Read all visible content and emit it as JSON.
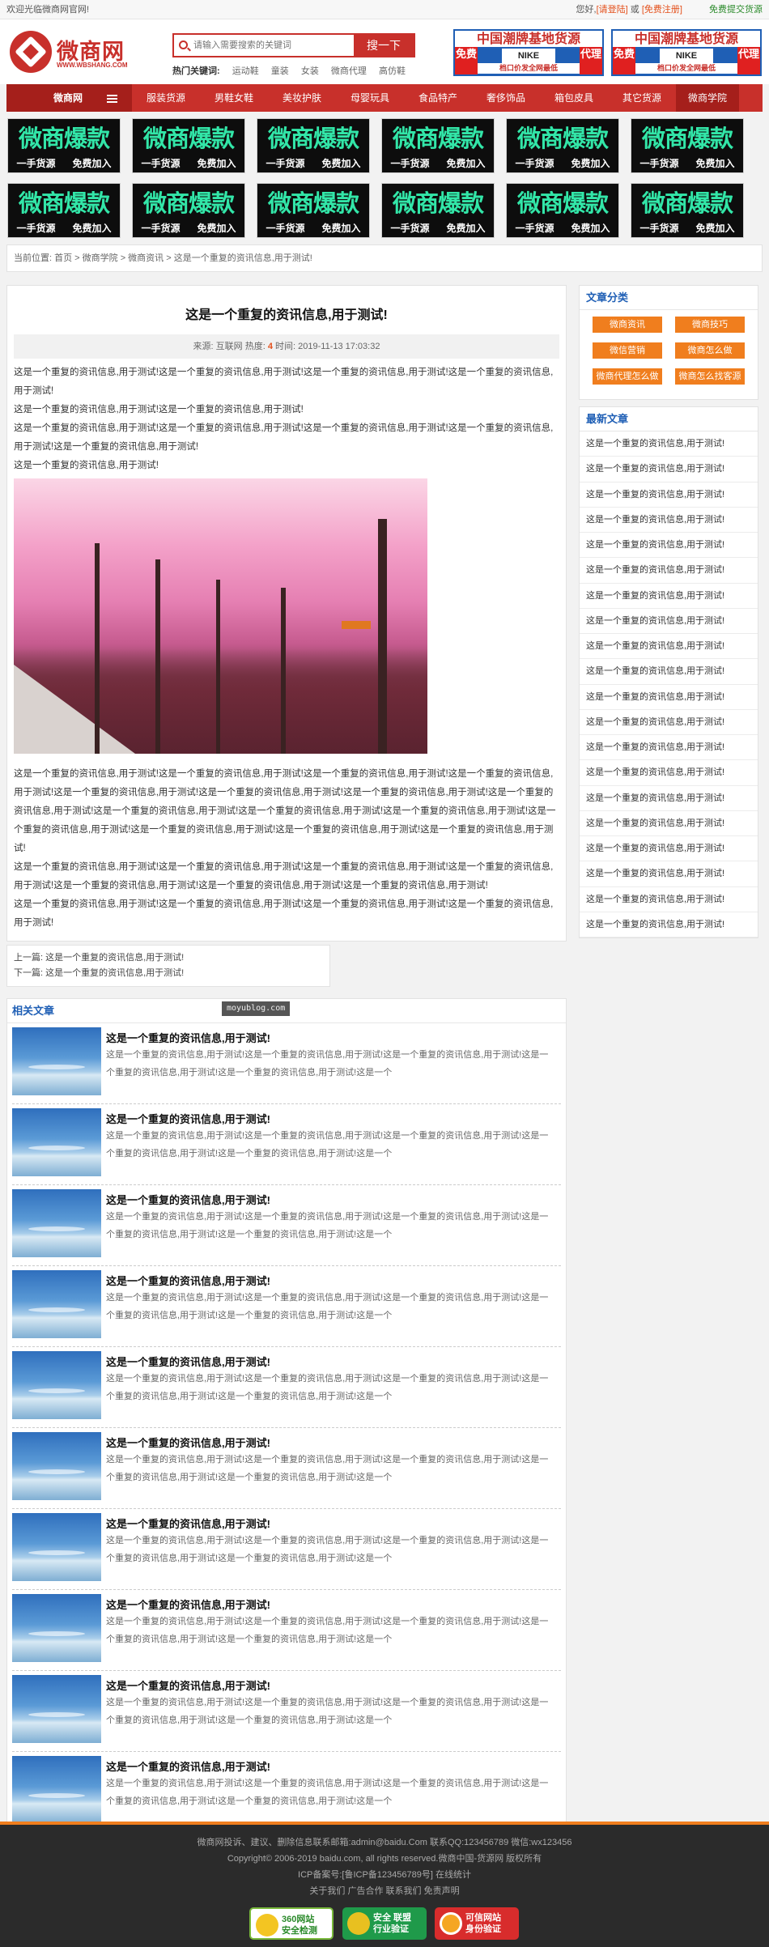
{
  "topbar": {
    "welcome": "欢迎光临微商网官网!",
    "greet": "您好,",
    "login": "[请登陆]",
    "or": "或",
    "register": "[免费注册]",
    "free_submit": "免费提交货源"
  },
  "header": {
    "logo_cn": "微商网",
    "logo_en": "WWW.WBSHANG.COM",
    "search_placeholder": "请输入需要搜索的关键词",
    "search_button": "搜一下",
    "hot_label": "热门关键词:",
    "hot_keywords": [
      "运动鞋",
      "童装",
      "女装",
      "微商代理",
      "高仿鞋"
    ],
    "banner": {
      "title": "中国潮牌基地货源",
      "left": "免费",
      "right": "代理",
      "brand": "NIKE",
      "bottom": "档口价发全网最低"
    }
  },
  "nav": {
    "category": "微商网",
    "items": [
      "服装货源",
      "男鞋女鞋",
      "美妆护肤",
      "母婴玩具",
      "食品特产",
      "奢侈饰品",
      "箱包皮具",
      "其它货源",
      "微商学院"
    ],
    "active_index": 8
  },
  "ads": {
    "big": "微商爆款",
    "left": "一手货源",
    "right": "免费加入",
    "count": 12
  },
  "breadcrumb": "当前位置: 首页 > 微商学院 > 微商资讯 > 这是一个重复的资讯信息,用于测试!",
  "article": {
    "title": "这是一个重复的资讯信息,用于测试!",
    "meta_source": "来源: 互联网 热度:",
    "meta_hot": "4",
    "meta_time": "时间: 2019-11-13 17:03:32",
    "paras_top": [
      "这是一个重复的资讯信息,用于测试!这是一个重复的资讯信息,用于测试!这是一个重复的资讯信息,用于测试!这是一个重复的资讯信息,用于测试!",
      "这是一个重复的资讯信息,用于测试!这是一个重复的资讯信息,用于测试!",
      "这是一个重复的资讯信息,用于测试!这是一个重复的资讯信息,用于测试!这是一个重复的资讯信息,用于测试!这是一个重复的资讯信息,用于测试!这是一个重复的资讯信息,用于测试!",
      "这是一个重复的资讯信息,用于测试!"
    ],
    "paras_bottom": [
      "这是一个重复的资讯信息,用于测试!这是一个重复的资讯信息,用于测试!这是一个重复的资讯信息,用于测试!这是一个重复的资讯信息,用于测试!这是一个重复的资讯信息,用于测试!这是一个重复的资讯信息,用于测试!这是一个重复的资讯信息,用于测试!这是一个重复的资讯信息,用于测试!这是一个重复的资讯信息,用于测试!这是一个重复的资讯信息,用于测试!这是一个重复的资讯信息,用于测试!这是一个重复的资讯信息,用于测试!这是一个重复的资讯信息,用于测试!这是一个重复的资讯信息,用于测试!这是一个重复的资讯信息,用于测试!",
      "这是一个重复的资讯信息,用于测试!这是一个重复的资讯信息,用于测试!这是一个重复的资讯信息,用于测试!这是一个重复的资讯信息,用于测试!这是一个重复的资讯信息,用于测试!这是一个重复的资讯信息,用于测试!这是一个重复的资讯信息,用于测试!",
      "这是一个重复的资讯信息,用于测试!这是一个重复的资讯信息,用于测试!这是一个重复的资讯信息,用于测试!这是一个重复的资讯信息,用于测试!"
    ]
  },
  "prevnext": {
    "prev": "上一篇: 这是一个重复的资讯信息,用于测试!",
    "next": "下一篇: 这是一个重复的资讯信息,用于测试!"
  },
  "related": {
    "heading": "相关文章",
    "watermark": "moyublog.com",
    "item_title": "这是一个重复的资讯信息,用于测试!",
    "item_desc": "这是一个重复的资讯信息,用于测试!这是一个重复的资讯信息,用于测试!这是一个重复的资讯信息,用于测试!这是一个重复的资讯信息,用于测试!这是一个重复的资讯信息,用于测试!这是一个",
    "count": 10
  },
  "sidebar": {
    "cat_heading": "文章分类",
    "tags": [
      "微商资讯",
      "微商技巧",
      "微信营销",
      "微商怎么做",
      "微商代理怎么做",
      "微商怎么找客源"
    ],
    "latest_heading": "最新文章",
    "latest_item": "这是一个重复的资讯信息,用于测试!",
    "latest_count": 20
  },
  "footer": {
    "line1": "微商网投诉、建议、删除信息联系邮箱:admin@baidu.Com 联系QQ:123456789 微信:wx123456",
    "line2": "Copyright© 2006-2019 baidu.com, all rights reserved.微商中国-货源网 版权所有",
    "line3": "ICP备案号:[鲁ICP备123456789号] 在线统计",
    "line4": "关于我们 广告合作 联系我们 免责声明",
    "badges": [
      {
        "t1": "360网站",
        "t2": "安全检测"
      },
      {
        "t1": "安全 联盟",
        "t2": "行业验证"
      },
      {
        "t1": "可信网站",
        "t2": "身份验证"
      }
    ]
  }
}
